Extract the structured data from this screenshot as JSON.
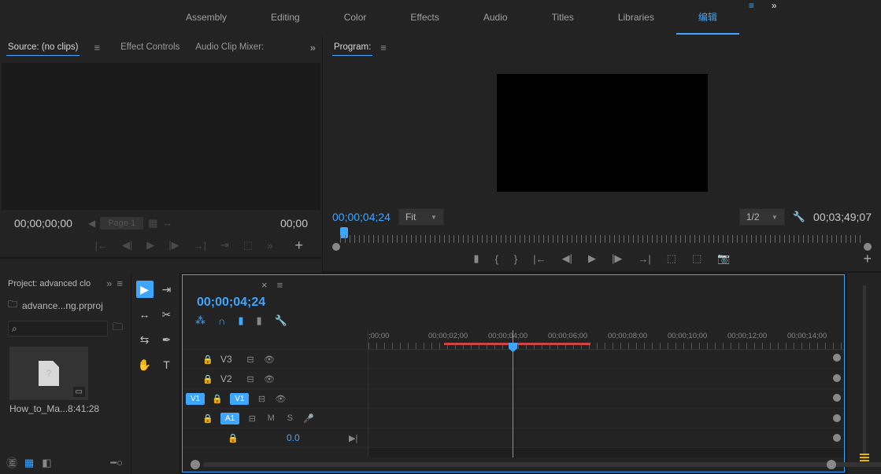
{
  "workspaces": {
    "tabs": [
      "Assembly",
      "Editing",
      "Color",
      "Effects",
      "Audio",
      "Titles",
      "Libraries"
    ],
    "active": "编辑",
    "more": "»"
  },
  "source": {
    "tabs": {
      "source": "Source: (no clips)",
      "effects": "Effect Controls",
      "audioMixer": "Audio Clip Mixer:"
    },
    "timecode_left": "00;00;00;00",
    "timecode_right": "00;00",
    "page_label": "Page 1",
    "more": "»"
  },
  "program": {
    "tab": "Program:",
    "timecode": "00;00;04;24",
    "fit": "Fit",
    "scale": "1/2",
    "duration": "00;03;49;07"
  },
  "project": {
    "title": "Project: advanced clo",
    "file": "advance...ng.prproj",
    "clip_name": "How_to_Ma...",
    "clip_dur": "8:41:28",
    "more": "»"
  },
  "timeline": {
    "timecode": "00;00;04;24",
    "mix_value": "0.0",
    "tracks": {
      "v3": "V3",
      "v2": "V2",
      "v1": "V1",
      "a1": "A1"
    },
    "ruler": [
      ";00;00",
      "00;00;02;00",
      "00;00;04;00",
      "00;00;06;00",
      "00;00;08;00",
      "00;00;10;00",
      "00;00;12;00",
      "00;00;14;00"
    ],
    "m_label": "M",
    "s_label": "S"
  },
  "icons": {
    "hamburger": "≡",
    "close": "×",
    "more": "»",
    "plus": "+",
    "question": "?",
    "play": "▶",
    "pause": "❚❚",
    "step_fwd": "❚▶",
    "step_back": "◀❚",
    "prev": "|◀",
    "next": "▶|",
    "in": "{",
    "out": "}",
    "marker": "◆",
    "search": "⌕",
    "folder": "🗀",
    "wrench": "🔧",
    "camera": "📷",
    "lock": "🔒",
    "eye": "👁",
    "target": "⊙",
    "mic": "🎤",
    "trash": "🗑",
    "list": "≣",
    "grid": "▦",
    "cc": "ⓒ"
  }
}
